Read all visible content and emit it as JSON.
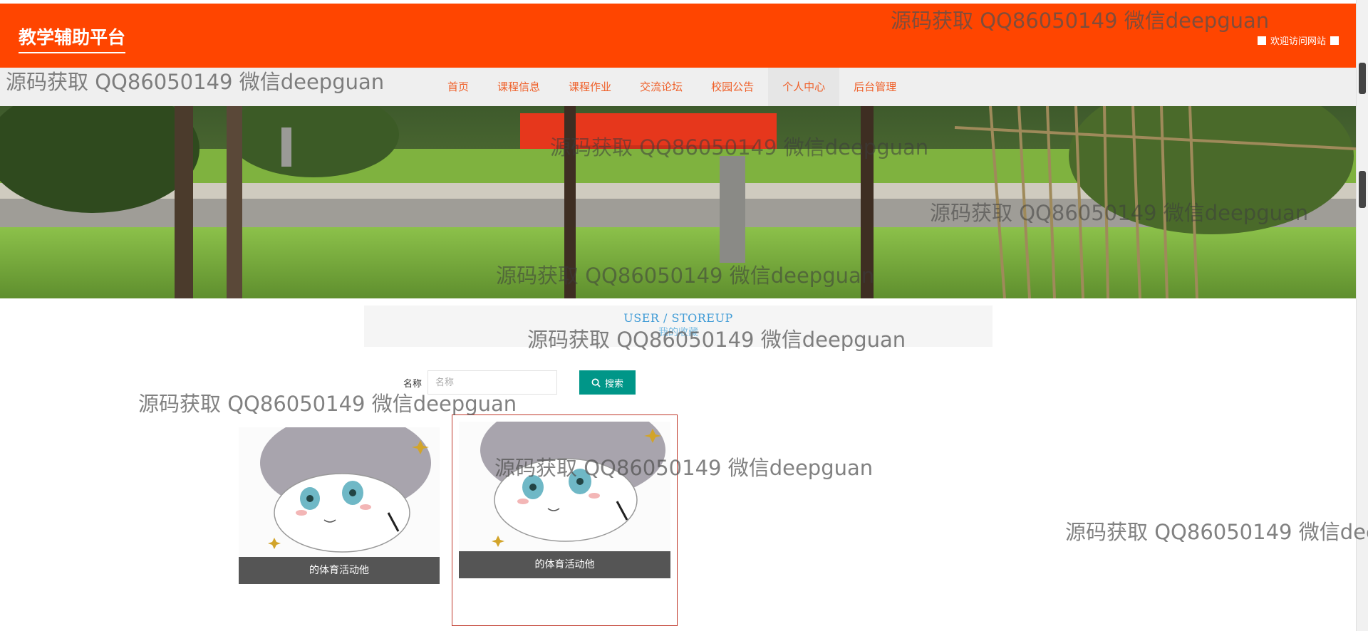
{
  "header": {
    "logo": "教学辅助平台",
    "welcome": "欢迎访问网站"
  },
  "nav": {
    "items": [
      {
        "label": "首页",
        "active": false
      },
      {
        "label": "课程信息",
        "active": false
      },
      {
        "label": "课程作业",
        "active": false
      },
      {
        "label": "交流论坛",
        "active": false
      },
      {
        "label": "校园公告",
        "active": false
      },
      {
        "label": "个人中心",
        "active": true
      },
      {
        "label": "后台管理",
        "active": false
      }
    ]
  },
  "page_title": {
    "en": "USER / STOREUP",
    "cn": "我的收藏"
  },
  "search": {
    "label": "名称",
    "placeholder": "名称",
    "button_label": "搜索"
  },
  "cards": [
    {
      "title": "的体育活动他"
    },
    {
      "title": "的体育活动他"
    }
  ],
  "watermark": "源码获取 QQ86050149 微信deepguan",
  "colors": {
    "header_bg": "#ff4500",
    "nav_text": "#ef5f28",
    "search_button": "#009688",
    "title_text": "#3f9bd6"
  }
}
